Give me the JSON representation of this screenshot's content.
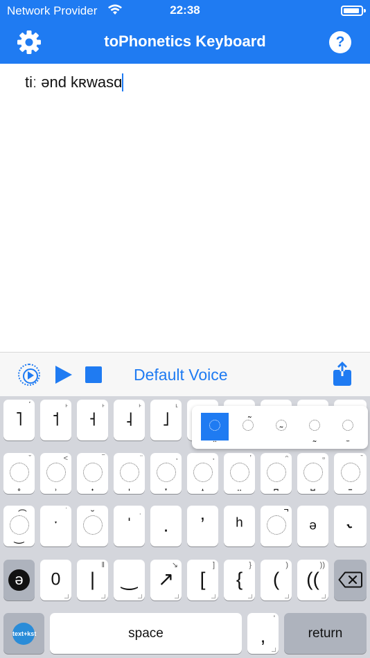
{
  "status": {
    "carrier": "Network Provider",
    "time": "22:38"
  },
  "navbar": {
    "title": "toPhonetics Keyboard",
    "help": "?"
  },
  "editor": {
    "text": "tiː ənd kʀwasɑ"
  },
  "player": {
    "voice": "Default Voice"
  },
  "keyboard": {
    "row1": [
      {
        "main": "˥",
        "sub": "˹"
      },
      {
        "main": "˦",
        "sub": "˫"
      },
      {
        "main": "˧",
        "sub": "˫"
      },
      {
        "main": "˨",
        "sub": "˫"
      },
      {
        "main": "˩",
        "sub": "˪"
      }
    ],
    "row2_diacritics": [
      "̥",
      "̹",
      "̟",
      "̩",
      "̞",
      "̝",
      "̤",
      "̪",
      "̺",
      "̠"
    ],
    "row2_top": [
      "ˇ",
      "˂",
      "‾",
      "̈",
      "˖",
      "˖",
      "ʼ",
      "ᵔ",
      "▫",
      "ˉ"
    ],
    "row3": [
      {
        "type": "circ",
        "diac": "‿",
        "top": "͡"
      },
      {
        "main": "ˑ",
        "sub": "˙"
      },
      {
        "type": "circ",
        "top": "̆"
      },
      {
        "main": "ˈ",
        "sub": "ˌ"
      },
      {
        "main": ".",
        "sub": ""
      },
      {
        "main": "ʼ",
        "sub": ""
      },
      {
        "main": "ʰ",
        "sub": ""
      },
      {
        "type": "circ",
        "top": "̚"
      },
      {
        "main": "ə",
        "sub": ""
      },
      {
        "main": "˞",
        "sub": ""
      }
    ],
    "row4": [
      {
        "main": "0",
        "sub": ""
      },
      {
        "main": "|",
        "sub": "‖"
      },
      {
        "main": "‿",
        "sub": ""
      },
      {
        "main": "↗",
        "sub": "↘"
      },
      {
        "main": "[",
        "sub": "]"
      },
      {
        "main": "{",
        "sub": "}"
      },
      {
        "main": "(",
        "sub": ")"
      },
      {
        "main": "((",
        "sub": "))"
      }
    ],
    "space": "space",
    "comma": ",",
    "comma_sub": "'",
    "return": "return",
    "schwa_key": "ə",
    "globe_label": "text+kst"
  },
  "popup": {
    "options": [
      "̤",
      "̃",
      "̴",
      "̰",
      "̼"
    ]
  },
  "colors": {
    "accent": "#1f7bf2",
    "keyboard_bg": "#d4d6dc"
  }
}
